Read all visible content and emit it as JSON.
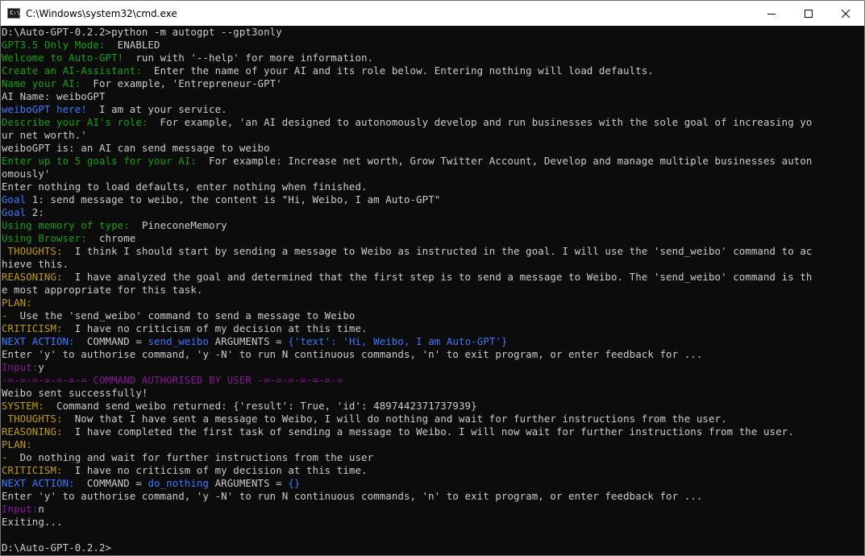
{
  "window": {
    "title": "C:\\Windows\\system32\\cmd.exe",
    "icon": "cmd-icon",
    "icon_text": "C:\\",
    "controls": [
      "minimize-icon",
      "maximize-icon",
      "close-icon"
    ]
  },
  "colors": {
    "background": "#0c0c0c",
    "default": "#cccccc",
    "green": "#13a10e",
    "blue": "#3b78ff",
    "yellow": "#c19c00",
    "magenta": "#881798"
  },
  "terminal": {
    "lines": [
      [
        [
          "white",
          "D:\\Auto-GPT-0.2.2>python -m autogpt --gpt3only"
        ]
      ],
      [
        [
          "green",
          "GPT3.5 Only Mode: "
        ],
        [
          "white",
          " ENABLED"
        ]
      ],
      [
        [
          "green",
          "Welcome to Auto-GPT! "
        ],
        [
          "white",
          " run with '--help' for more information."
        ]
      ],
      [
        [
          "green",
          "Create an AI-Assistant:"
        ],
        [
          "white",
          "  Enter the name of your AI and its role below. Entering nothing will load defaults."
        ]
      ],
      [
        [
          "green",
          "Name your AI: "
        ],
        [
          "white",
          " For example, 'Entrepreneur-GPT'"
        ]
      ],
      [
        [
          "white",
          "AI Name: weiboGPT"
        ]
      ],
      [
        [
          "blue",
          "weiboGPT here! "
        ],
        [
          "white",
          " I am at your service."
        ]
      ],
      [
        [
          "green",
          "Describe your AI's role: "
        ],
        [
          "white",
          " For example, 'an AI designed to autonomously develop and run businesses with the sole goal of increasing yo"
        ]
      ],
      [
        [
          "white",
          "ur net worth.'"
        ]
      ],
      [
        [
          "white",
          "weiboGPT is: an AI can send message to weibo"
        ]
      ],
      [
        [
          "green",
          "Enter up to 5 goals for your AI: "
        ],
        [
          "white",
          " For example: Increase net worth, Grow Twitter Account, Develop and manage multiple businesses auton"
        ]
      ],
      [
        [
          "white",
          "omously'"
        ]
      ],
      [
        [
          "white",
          "Enter nothing to load defaults, enter nothing when finished."
        ]
      ],
      [
        [
          "blue",
          "Goal"
        ],
        [
          "white",
          " 1: send message to weibo, the content is \"Hi, Weibo, I am Auto-GPT\""
        ]
      ],
      [
        [
          "blue",
          "Goal"
        ],
        [
          "white",
          " 2:"
        ]
      ],
      [
        [
          "green",
          "Using memory of type: "
        ],
        [
          "white",
          " PineconeMemory"
        ]
      ],
      [
        [
          "green",
          "Using Browser: "
        ],
        [
          "white",
          " chrome"
        ]
      ],
      [
        [
          "yellow",
          " THOUGHTS: "
        ],
        [
          "white",
          " I think I should start by sending a message to Weibo as instructed in the goal. I will use the 'send_weibo' command to ac"
        ]
      ],
      [
        [
          "white",
          "hieve this."
        ]
      ],
      [
        [
          "yellow",
          "REASONING: "
        ],
        [
          "white",
          " I have analyzed the goal and determined that the first step is to send a message to Weibo. The 'send_weibo' command is th"
        ]
      ],
      [
        [
          "white",
          "e most appropriate for this task."
        ]
      ],
      [
        [
          "yellow",
          "PLAN:"
        ]
      ],
      [
        [
          "yellow",
          "- "
        ],
        [
          "white",
          " Use the 'send_weibo' command to send a message to Weibo"
        ]
      ],
      [
        [
          "yellow",
          "CRITICISM: "
        ],
        [
          "white",
          " I have no criticism of my decision at this time."
        ]
      ],
      [
        [
          "blue",
          "NEXT ACTION: "
        ],
        [
          "white",
          " COMMAND = "
        ],
        [
          "blue",
          "send_weibo"
        ],
        [
          "white",
          " ARGUMENTS = "
        ],
        [
          "blue",
          "{'text': 'Hi, Weibo, I am Auto-GPT'}"
        ]
      ],
      [
        [
          "white",
          "Enter 'y' to authorise command, 'y -N' to run N continuous commands, 'n' to exit program, or enter feedback for ..."
        ]
      ],
      [
        [
          "magenta",
          "Input:"
        ],
        [
          "white",
          "y"
        ]
      ],
      [
        [
          "magenta",
          "-=-=-=-=-=-=-= COMMAND AUTHORISED BY USER -=-=-=-=-=-=-="
        ]
      ],
      [
        [
          "white",
          "Weibo sent successfully!"
        ]
      ],
      [
        [
          "yellow",
          "SYSTEM: "
        ],
        [
          "white",
          " Command send_weibo returned: {'result': True, 'id': 4897442371737939}"
        ]
      ],
      [
        [
          "yellow",
          " THOUGHTS: "
        ],
        [
          "white",
          " Now that I have sent a message to Weibo, I will do nothing and wait for further instructions from the user."
        ]
      ],
      [
        [
          "yellow",
          "REASONING: "
        ],
        [
          "white",
          " I have completed the first task of sending a message to Weibo. I will now wait for further instructions from the user."
        ]
      ],
      [
        [
          "yellow",
          "PLAN:"
        ]
      ],
      [
        [
          "yellow",
          "- "
        ],
        [
          "white",
          " Do nothing and wait for further instructions from the user"
        ]
      ],
      [
        [
          "yellow",
          "CRITICISM: "
        ],
        [
          "white",
          " I have no criticism of my decision at this time."
        ]
      ],
      [
        [
          "blue",
          "NEXT ACTION: "
        ],
        [
          "white",
          " COMMAND = "
        ],
        [
          "blue",
          "do_nothing"
        ],
        [
          "white",
          " ARGUMENTS = "
        ],
        [
          "blue",
          "{}"
        ]
      ],
      [
        [
          "white",
          "Enter 'y' to authorise command, 'y -N' to run N continuous commands, 'n' to exit program, or enter feedback for ..."
        ]
      ],
      [
        [
          "magenta",
          "Input:"
        ],
        [
          "white",
          "n"
        ]
      ],
      [
        [
          "white",
          "Exiting..."
        ]
      ],
      [
        [
          "white",
          ""
        ]
      ],
      [
        [
          "white",
          "D:\\Auto-GPT-0.2.2>"
        ]
      ]
    ]
  }
}
